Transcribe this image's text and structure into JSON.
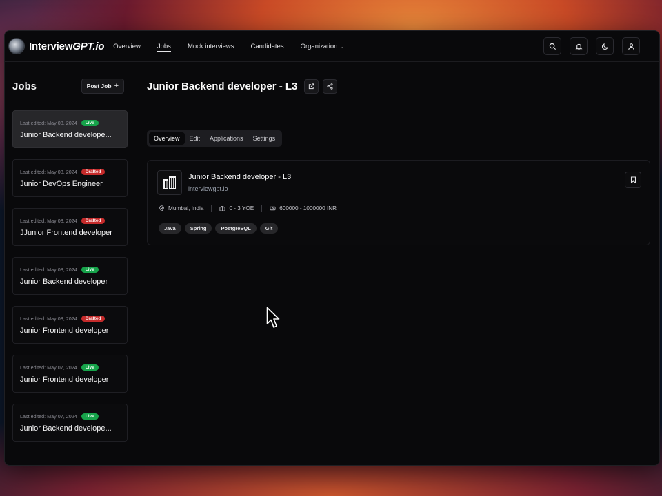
{
  "app": {
    "logo_main": "Interview",
    "logo_em": "GPT.io"
  },
  "nav": {
    "links": [
      {
        "label": "Overview"
      },
      {
        "label": "Jobs",
        "active": true
      },
      {
        "label": "Mock interviews"
      },
      {
        "label": "Candidates"
      },
      {
        "label": "Organization",
        "dropdown": true
      }
    ],
    "icons": [
      "search-icon",
      "bell-icon",
      "moon-icon",
      "user-icon"
    ]
  },
  "sidebar": {
    "title": "Jobs",
    "post_button": "Post Job",
    "post_icon": "+",
    "jobs": [
      {
        "date": "Last edited: May 08, 2024",
        "status": "Live",
        "title": "Junior Backend develope...",
        "selected": true
      },
      {
        "date": "Last edited: May 08, 2024",
        "status": "Drafted",
        "title": "Junior DevOps Engineer"
      },
      {
        "date": "Last edited: May 08, 2024",
        "status": "Drafted",
        "title": "JJunior Frontend developer"
      },
      {
        "date": "Last edited: May 08, 2024",
        "status": "Live",
        "title": "Junior Backend developer"
      },
      {
        "date": "Last edited: May 08, 2024",
        "status": "Drafted",
        "title": "Junior Frontend developer"
      },
      {
        "date": "Last edited: May 07, 2024",
        "status": "Live",
        "title": "Junior Frontend developer"
      },
      {
        "date": "Last edited: May 07, 2024",
        "status": "Live",
        "title": "Junior Backend develope..."
      }
    ]
  },
  "main": {
    "title": "Junior Backend developer - L3",
    "tabs": [
      {
        "label": "Overview",
        "active": true
      },
      {
        "label": "Edit"
      },
      {
        "label": "Applications"
      },
      {
        "label": "Settings"
      }
    ],
    "job": {
      "title": "Junior Backend developer - L3",
      "company_domain": "interviewgpt.io",
      "location": "Mumbai, India",
      "experience": "0 - 3 YOE",
      "salary": "600000 - 1000000 INR",
      "tags": [
        "Java",
        "Spring",
        "PostgreSQL",
        "Git"
      ]
    }
  },
  "colors": {
    "live": "#16a34a",
    "drafted": "#c52b2b",
    "background": "#09090b"
  }
}
